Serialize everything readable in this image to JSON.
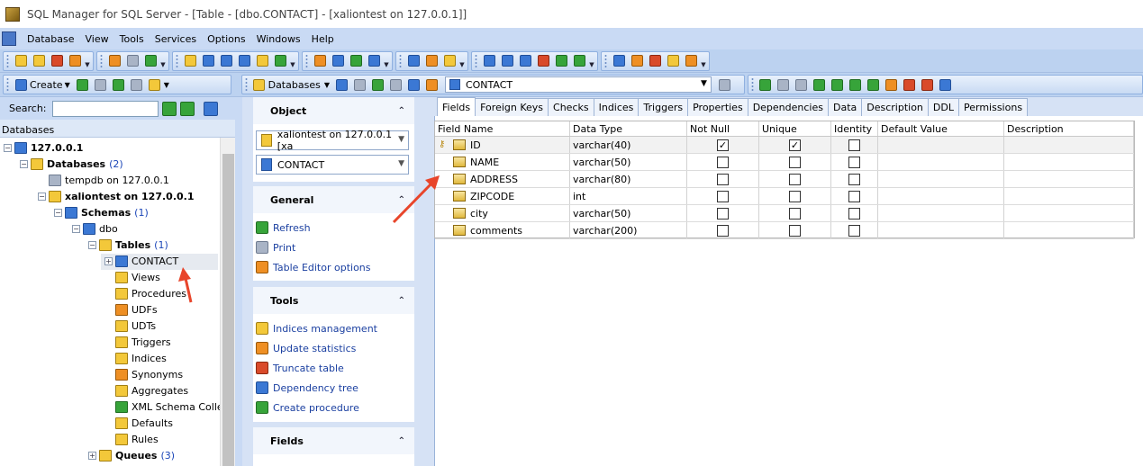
{
  "window": {
    "title": "SQL Manager for SQL Server - [Table - [dbo.CONTACT] - [xaliontest on 127.0.0.1]]"
  },
  "menu": [
    "Database",
    "View",
    "Tools",
    "Services",
    "Options",
    "Windows",
    "Help"
  ],
  "left_toolbar": {
    "create_label": "Create"
  },
  "search": {
    "label": "Search:",
    "placeholder": ""
  },
  "tree_header": "Databases",
  "tree": [
    {
      "label": "127.0.0.1",
      "bold": true
    },
    {
      "label": "Databases",
      "count": "(2)",
      "bold": true
    },
    {
      "label": "tempdb on 127.0.0.1"
    },
    {
      "label": "xaliontest on 127.0.0.1",
      "bold": true
    },
    {
      "label": "Schemas",
      "count": "(1)",
      "bold": true
    },
    {
      "label": "dbo"
    },
    {
      "label": "Tables",
      "count": "(1)",
      "bold": true
    },
    {
      "label": "CONTACT"
    },
    {
      "label": "Views"
    },
    {
      "label": "Procedures"
    },
    {
      "label": "UDFs"
    },
    {
      "label": "UDTs"
    },
    {
      "label": "Triggers"
    },
    {
      "label": "Indices"
    },
    {
      "label": "Synonyms"
    },
    {
      "label": "Aggregates"
    },
    {
      "label": "XML Schema Collecti..."
    },
    {
      "label": "Defaults"
    },
    {
      "label": "Rules"
    },
    {
      "label": "Queues",
      "count": "(3)",
      "bold": true
    }
  ],
  "main_toolbar": {
    "databases_label": "Databases",
    "object_combo": "CONTACT"
  },
  "nav_panel": {
    "object": {
      "title": "Object",
      "db_combo": "xaliontest on 127.0.0.1 [xa",
      "table_combo": "CONTACT"
    },
    "general": {
      "title": "General",
      "items": [
        "Refresh",
        "Print",
        "Table Editor options"
      ]
    },
    "tools": {
      "title": "Tools",
      "items": [
        "Indices management",
        "Update statistics",
        "Truncate table",
        "Dependency tree",
        "Create procedure"
      ]
    },
    "fields": {
      "title": "Fields"
    }
  },
  "tabs": [
    "Fields",
    "Foreign Keys",
    "Checks",
    "Indices",
    "Triggers",
    "Properties",
    "Dependencies",
    "Data",
    "Description",
    "DDL",
    "Permissions"
  ],
  "active_tab": "Fields",
  "grid": {
    "columns": [
      "Field Name",
      "Data Type",
      "Not Null",
      "Unique",
      "Identity",
      "Default Value",
      "Description"
    ],
    "rows": [
      {
        "name": "ID",
        "type": "varchar(40)",
        "not_null": true,
        "unique": true,
        "identity": false,
        "primary_key": true
      },
      {
        "name": "NAME",
        "type": "varchar(50)",
        "not_null": false,
        "unique": false,
        "identity": false
      },
      {
        "name": "ADDRESS",
        "type": "varchar(80)",
        "not_null": false,
        "unique": false,
        "identity": false
      },
      {
        "name": "ZIPCODE",
        "type": "int",
        "not_null": false,
        "unique": false,
        "identity": false
      },
      {
        "name": "city",
        "type": "varchar(50)",
        "not_null": false,
        "unique": false,
        "identity": false
      },
      {
        "name": "comments",
        "type": "varchar(200)",
        "not_null": false,
        "unique": false,
        "identity": false
      }
    ]
  },
  "colors": {
    "accent": "#c9daf4",
    "annotation_arrow": "#e8452b",
    "link": "#1a3fa0"
  }
}
